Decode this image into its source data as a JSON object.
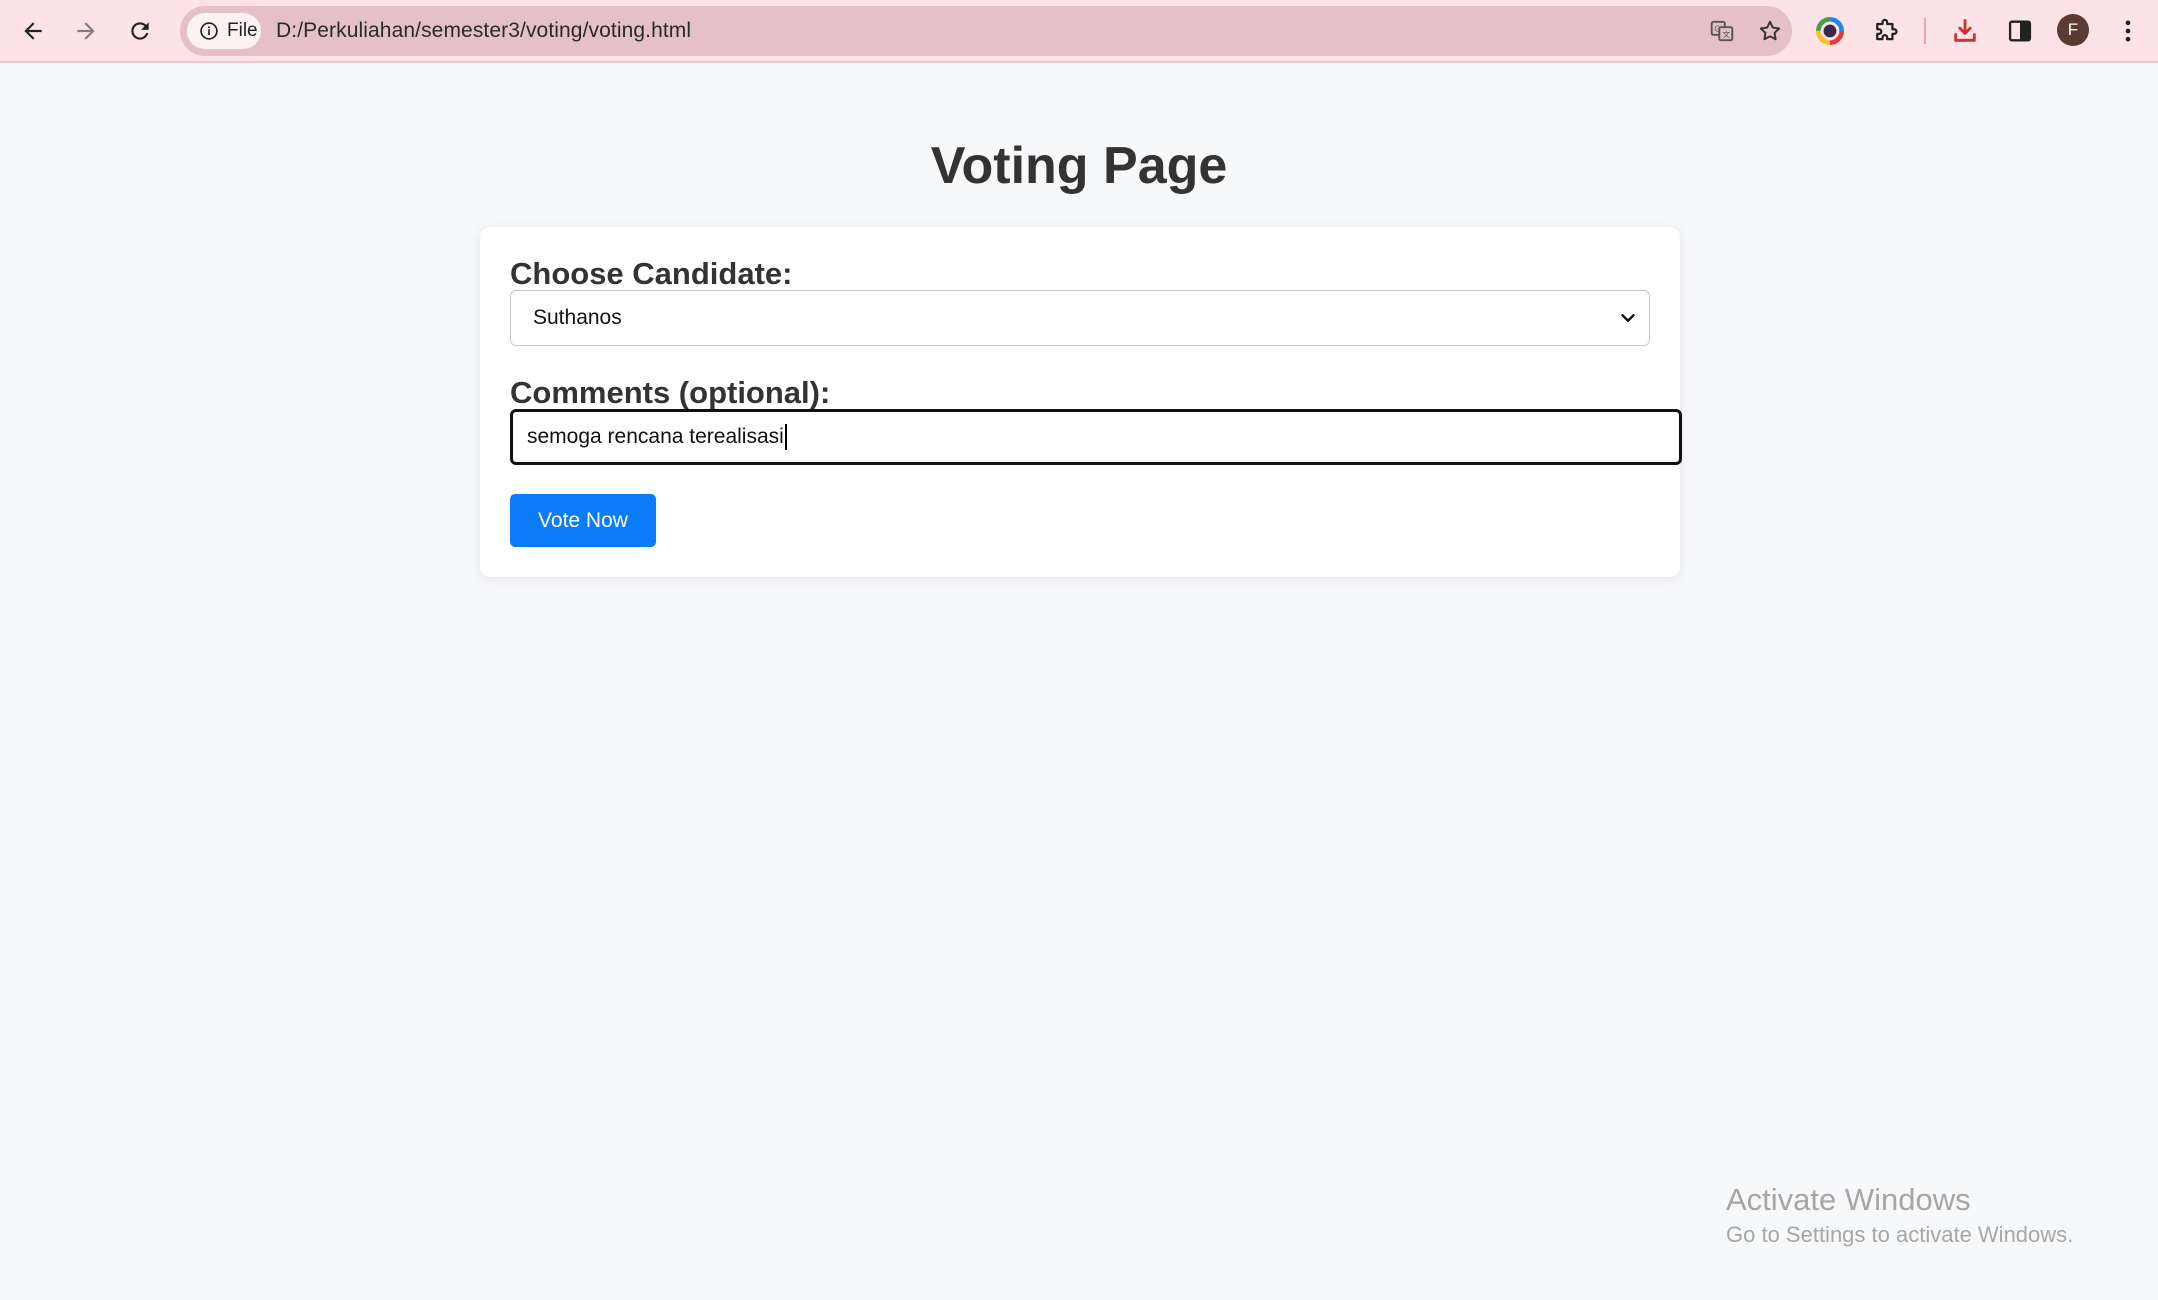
{
  "browser": {
    "chip_label": "File",
    "url": "D:/Perkuliahan/semester3/voting/voting.html",
    "profile_initial": "F",
    "icons": {
      "back": "back-arrow-icon",
      "forward": "forward-arrow-icon",
      "reload": "reload-icon",
      "info": "info-icon",
      "translate": "translate-icon",
      "bookmark": "star-icon",
      "extension_color": "color-wheel-icon",
      "extensions": "puzzle-icon",
      "downloads": "download-icon",
      "side_panel": "side-panel-icon",
      "menu": "kebab-menu-icon"
    },
    "colors": {
      "toolbar_bg": "#fde3e6",
      "omnibox_bg": "#e5c1c7",
      "download_icon": "#d32f2f"
    }
  },
  "page": {
    "title": "Voting Page",
    "form": {
      "candidate_label": "Choose Candidate:",
      "candidate_selected": "Suthanos",
      "comments_label": "Comments (optional):",
      "comments_value": "semoga rencana terealisasi",
      "submit_label": "Vote Now"
    },
    "colors": {
      "button_bg": "#0a7cfa",
      "page_bg": "#f7f8fa"
    }
  },
  "watermark": {
    "title": "Activate Windows",
    "subtitle": "Go to Settings to activate Windows."
  }
}
